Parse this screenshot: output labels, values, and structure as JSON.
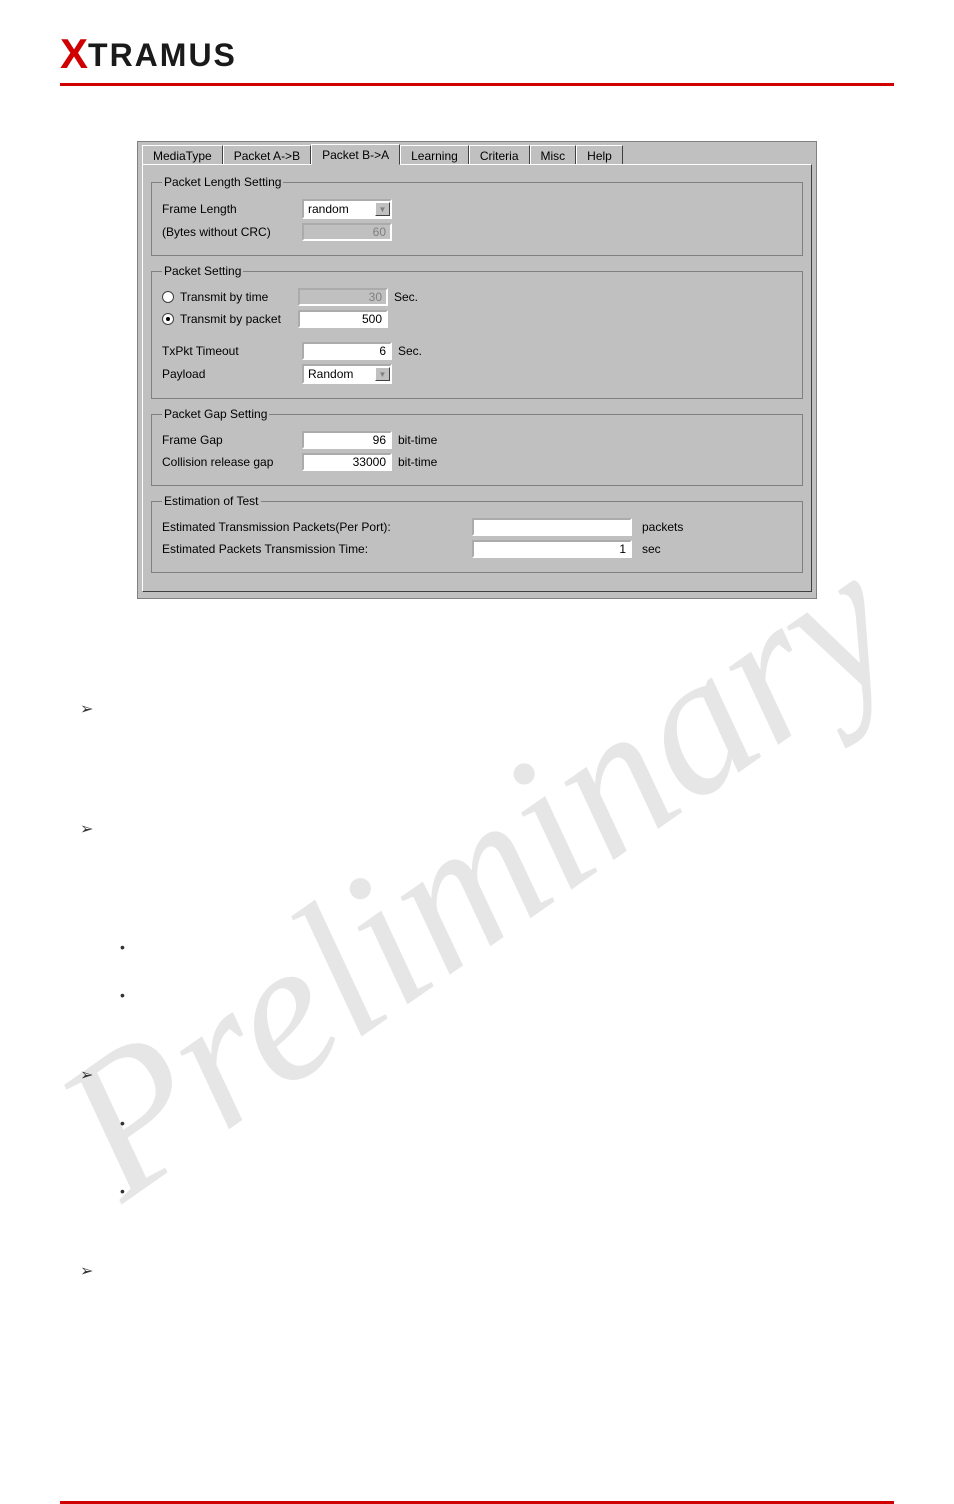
{
  "tabs": {
    "t0": "MediaType",
    "t1": "Packet A->B",
    "t2": "Packet B->A",
    "t3": "Learning",
    "t4": "Criteria",
    "t5": "Misc",
    "t6": "Help"
  },
  "pls": {
    "legend": "Packet Length Setting",
    "frame_length_lbl": "Frame Length",
    "frame_length_val": "random",
    "bytes_lbl": "(Bytes without CRC)",
    "bytes_val": "60"
  },
  "ps": {
    "legend": "Packet Setting",
    "tx_time_lbl": "Transmit by time",
    "tx_time_val": "30",
    "tx_time_unit": "Sec.",
    "tx_pkt_lbl": "Transmit by packet",
    "tx_pkt_val": "500",
    "txpkt_to_lbl": "TxPkt Timeout",
    "txpkt_to_val": "6",
    "txpkt_to_unit": "Sec.",
    "payload_lbl": "Payload",
    "payload_val": "Random"
  },
  "pgs": {
    "legend": "Packet Gap Setting",
    "frame_gap_lbl": "Frame Gap",
    "frame_gap_val": "96",
    "frame_gap_unit": "bit-time",
    "collision_lbl": "Collision release gap",
    "collision_val": "33000",
    "collision_unit": "bit-time"
  },
  "est": {
    "legend": "Estimation of Test",
    "pkts_lbl": "Estimated Transmission Packets(Per Port):",
    "pkts_val": "",
    "pkts_unit": "packets",
    "time_lbl": "Estimated Packets Transmission Time:",
    "time_val": "1",
    "time_unit": "sec"
  },
  "brand": {
    "x": "X",
    "rest": "TRAMUS"
  },
  "watermark": "Preliminary"
}
